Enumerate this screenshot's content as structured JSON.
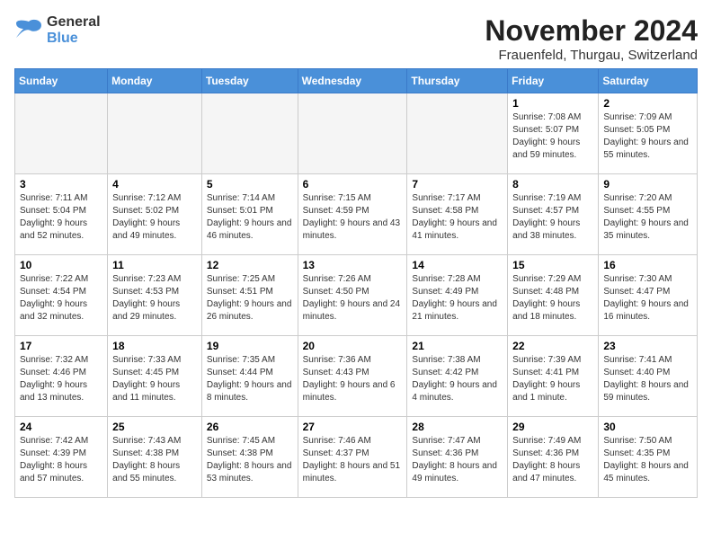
{
  "header": {
    "logo_line1": "General",
    "logo_line2": "Blue",
    "title": "November 2024",
    "subtitle": "Frauenfeld, Thurgau, Switzerland"
  },
  "weekdays": [
    "Sunday",
    "Monday",
    "Tuesday",
    "Wednesday",
    "Thursday",
    "Friday",
    "Saturday"
  ],
  "weeks": [
    {
      "days": [
        {
          "num": "",
          "info": "",
          "empty": true
        },
        {
          "num": "",
          "info": "",
          "empty": true
        },
        {
          "num": "",
          "info": "",
          "empty": true
        },
        {
          "num": "",
          "info": "",
          "empty": true
        },
        {
          "num": "",
          "info": "",
          "empty": true
        },
        {
          "num": "1",
          "info": "Sunrise: 7:08 AM\nSunset: 5:07 PM\nDaylight: 9 hours and 59 minutes."
        },
        {
          "num": "2",
          "info": "Sunrise: 7:09 AM\nSunset: 5:05 PM\nDaylight: 9 hours and 55 minutes."
        }
      ]
    },
    {
      "days": [
        {
          "num": "3",
          "info": "Sunrise: 7:11 AM\nSunset: 5:04 PM\nDaylight: 9 hours and 52 minutes."
        },
        {
          "num": "4",
          "info": "Sunrise: 7:12 AM\nSunset: 5:02 PM\nDaylight: 9 hours and 49 minutes."
        },
        {
          "num": "5",
          "info": "Sunrise: 7:14 AM\nSunset: 5:01 PM\nDaylight: 9 hours and 46 minutes."
        },
        {
          "num": "6",
          "info": "Sunrise: 7:15 AM\nSunset: 4:59 PM\nDaylight: 9 hours and 43 minutes."
        },
        {
          "num": "7",
          "info": "Sunrise: 7:17 AM\nSunset: 4:58 PM\nDaylight: 9 hours and 41 minutes."
        },
        {
          "num": "8",
          "info": "Sunrise: 7:19 AM\nSunset: 4:57 PM\nDaylight: 9 hours and 38 minutes."
        },
        {
          "num": "9",
          "info": "Sunrise: 7:20 AM\nSunset: 4:55 PM\nDaylight: 9 hours and 35 minutes."
        }
      ]
    },
    {
      "days": [
        {
          "num": "10",
          "info": "Sunrise: 7:22 AM\nSunset: 4:54 PM\nDaylight: 9 hours and 32 minutes."
        },
        {
          "num": "11",
          "info": "Sunrise: 7:23 AM\nSunset: 4:53 PM\nDaylight: 9 hours and 29 minutes."
        },
        {
          "num": "12",
          "info": "Sunrise: 7:25 AM\nSunset: 4:51 PM\nDaylight: 9 hours and 26 minutes."
        },
        {
          "num": "13",
          "info": "Sunrise: 7:26 AM\nSunset: 4:50 PM\nDaylight: 9 hours and 24 minutes."
        },
        {
          "num": "14",
          "info": "Sunrise: 7:28 AM\nSunset: 4:49 PM\nDaylight: 9 hours and 21 minutes."
        },
        {
          "num": "15",
          "info": "Sunrise: 7:29 AM\nSunset: 4:48 PM\nDaylight: 9 hours and 18 minutes."
        },
        {
          "num": "16",
          "info": "Sunrise: 7:30 AM\nSunset: 4:47 PM\nDaylight: 9 hours and 16 minutes."
        }
      ]
    },
    {
      "days": [
        {
          "num": "17",
          "info": "Sunrise: 7:32 AM\nSunset: 4:46 PM\nDaylight: 9 hours and 13 minutes."
        },
        {
          "num": "18",
          "info": "Sunrise: 7:33 AM\nSunset: 4:45 PM\nDaylight: 9 hours and 11 minutes."
        },
        {
          "num": "19",
          "info": "Sunrise: 7:35 AM\nSunset: 4:44 PM\nDaylight: 9 hours and 8 minutes."
        },
        {
          "num": "20",
          "info": "Sunrise: 7:36 AM\nSunset: 4:43 PM\nDaylight: 9 hours and 6 minutes."
        },
        {
          "num": "21",
          "info": "Sunrise: 7:38 AM\nSunset: 4:42 PM\nDaylight: 9 hours and 4 minutes."
        },
        {
          "num": "22",
          "info": "Sunrise: 7:39 AM\nSunset: 4:41 PM\nDaylight: 9 hours and 1 minute."
        },
        {
          "num": "23",
          "info": "Sunrise: 7:41 AM\nSunset: 4:40 PM\nDaylight: 8 hours and 59 minutes."
        }
      ]
    },
    {
      "days": [
        {
          "num": "24",
          "info": "Sunrise: 7:42 AM\nSunset: 4:39 PM\nDaylight: 8 hours and 57 minutes."
        },
        {
          "num": "25",
          "info": "Sunrise: 7:43 AM\nSunset: 4:38 PM\nDaylight: 8 hours and 55 minutes."
        },
        {
          "num": "26",
          "info": "Sunrise: 7:45 AM\nSunset: 4:38 PM\nDaylight: 8 hours and 53 minutes."
        },
        {
          "num": "27",
          "info": "Sunrise: 7:46 AM\nSunset: 4:37 PM\nDaylight: 8 hours and 51 minutes."
        },
        {
          "num": "28",
          "info": "Sunrise: 7:47 AM\nSunset: 4:36 PM\nDaylight: 8 hours and 49 minutes."
        },
        {
          "num": "29",
          "info": "Sunrise: 7:49 AM\nSunset: 4:36 PM\nDaylight: 8 hours and 47 minutes."
        },
        {
          "num": "30",
          "info": "Sunrise: 7:50 AM\nSunset: 4:35 PM\nDaylight: 8 hours and 45 minutes."
        }
      ]
    }
  ]
}
